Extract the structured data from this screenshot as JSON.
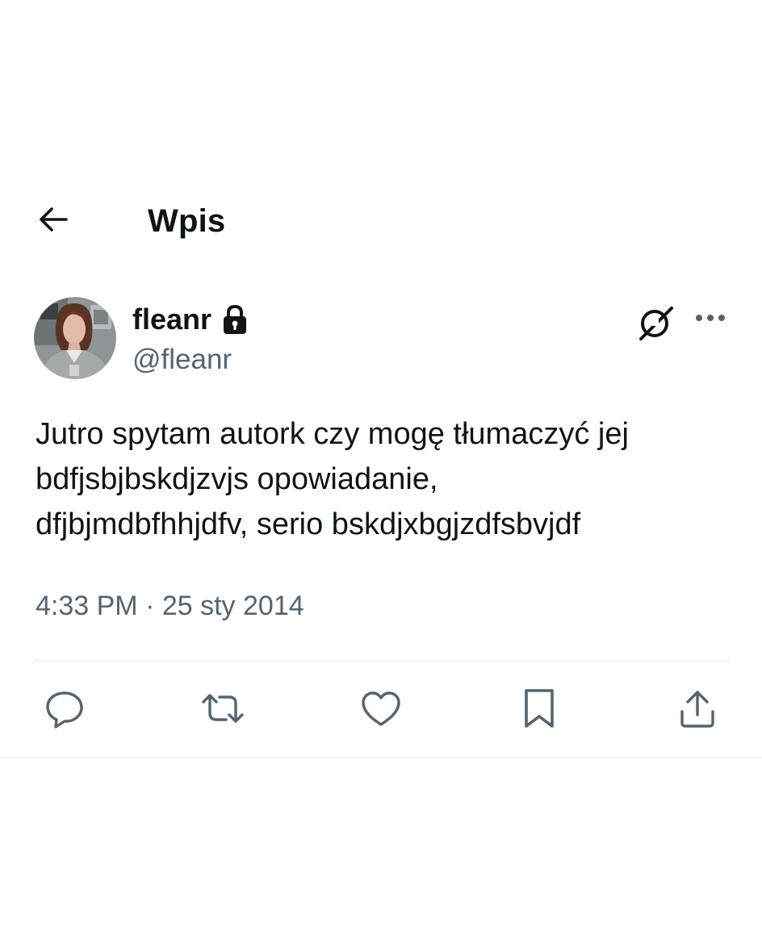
{
  "header": {
    "back_icon": "arrow-left-icon",
    "title": "Wpis"
  },
  "author": {
    "display_name": "fleanr",
    "handle": "@fleanr",
    "protected_icon": "lock-icon",
    "grok_icon": "grok-icon",
    "more_icon": "more-horizontal-icon"
  },
  "tweet": {
    "text": "Jutro spytam autork czy mogę tłumaczyć jej\nbdfjsbjbskdjzvjs opowiadanie,\ndfjbjmdbfhhjdfv, serio bskdjxbgjzdfsbvjdf",
    "time": "4:33 PM",
    "separator": " · ",
    "date": "25 sty 2014"
  },
  "actions": {
    "reply_icon": "reply-icon",
    "retweet_icon": "retweet-icon",
    "like_icon": "heart-icon",
    "bookmark_icon": "bookmark-icon",
    "share_icon": "share-icon"
  },
  "colors": {
    "text_primary": "#0f1419",
    "text_secondary": "#536471",
    "icon": "#536471",
    "divider": "#eff3f4"
  }
}
